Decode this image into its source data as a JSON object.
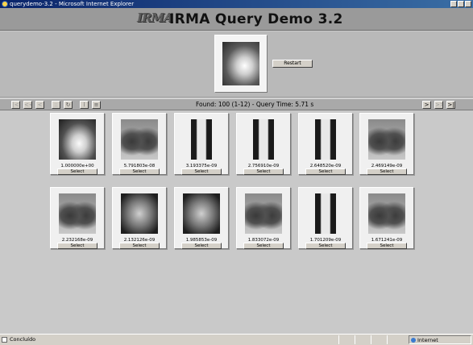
{
  "window": {
    "title": "querydemo-3.2 - Microsoft Internet Explorer"
  },
  "header": {
    "logo": "IRMA",
    "title": "IRMA Query Demo 3.2"
  },
  "query": {
    "restart_label": "Restart"
  },
  "navbar": {
    "found_text": "Found: 100 (1-12) - Query Time: 5.71 s",
    "first_glyph": "|<",
    "prev_fast_glyph": "<<",
    "prev_glyph": "<",
    "grid_small_glyph": "::",
    "refresh_glyph": "↻",
    "grid_glyph": "⁞",
    "list_glyph": "≡",
    "next_glyph": ">",
    "next_fast_glyph": ">>",
    "last_glyph": ">|"
  },
  "results": [
    {
      "value": "1.000000e+00",
      "select_label": "Select",
      "kind": "stomach"
    },
    {
      "value": "5.791803e-08",
      "select_label": "Select",
      "kind": "chest"
    },
    {
      "value": "3.193375e-09",
      "select_label": "Select",
      "kind": "hand"
    },
    {
      "value": "2.756910e-09",
      "select_label": "Select",
      "kind": "hand"
    },
    {
      "value": "2.648520e-09",
      "select_label": "Select",
      "kind": "hand"
    },
    {
      "value": "2.469149e-09",
      "select_label": "Select",
      "kind": "chest"
    },
    {
      "value": "2.232168e-09",
      "select_label": "Select",
      "kind": "chest"
    },
    {
      "value": "2.132126e-09",
      "select_label": "Select",
      "kind": "abdomen"
    },
    {
      "value": "1.985853e-09",
      "select_label": "Select",
      "kind": "abdomen"
    },
    {
      "value": "1.833072e-09",
      "select_label": "Select",
      "kind": "chest"
    },
    {
      "value": "1.701209e-09",
      "select_label": "Select",
      "kind": "hand"
    },
    {
      "value": "1.671241e-09",
      "select_label": "Select",
      "kind": "chest"
    }
  ],
  "statusbar": {
    "status_text": "Concluído",
    "zone_text": "Internet"
  },
  "colors": {
    "titlebar": "#0a246a",
    "header": "#9a9a9a",
    "background": "#c9c9c9"
  }
}
